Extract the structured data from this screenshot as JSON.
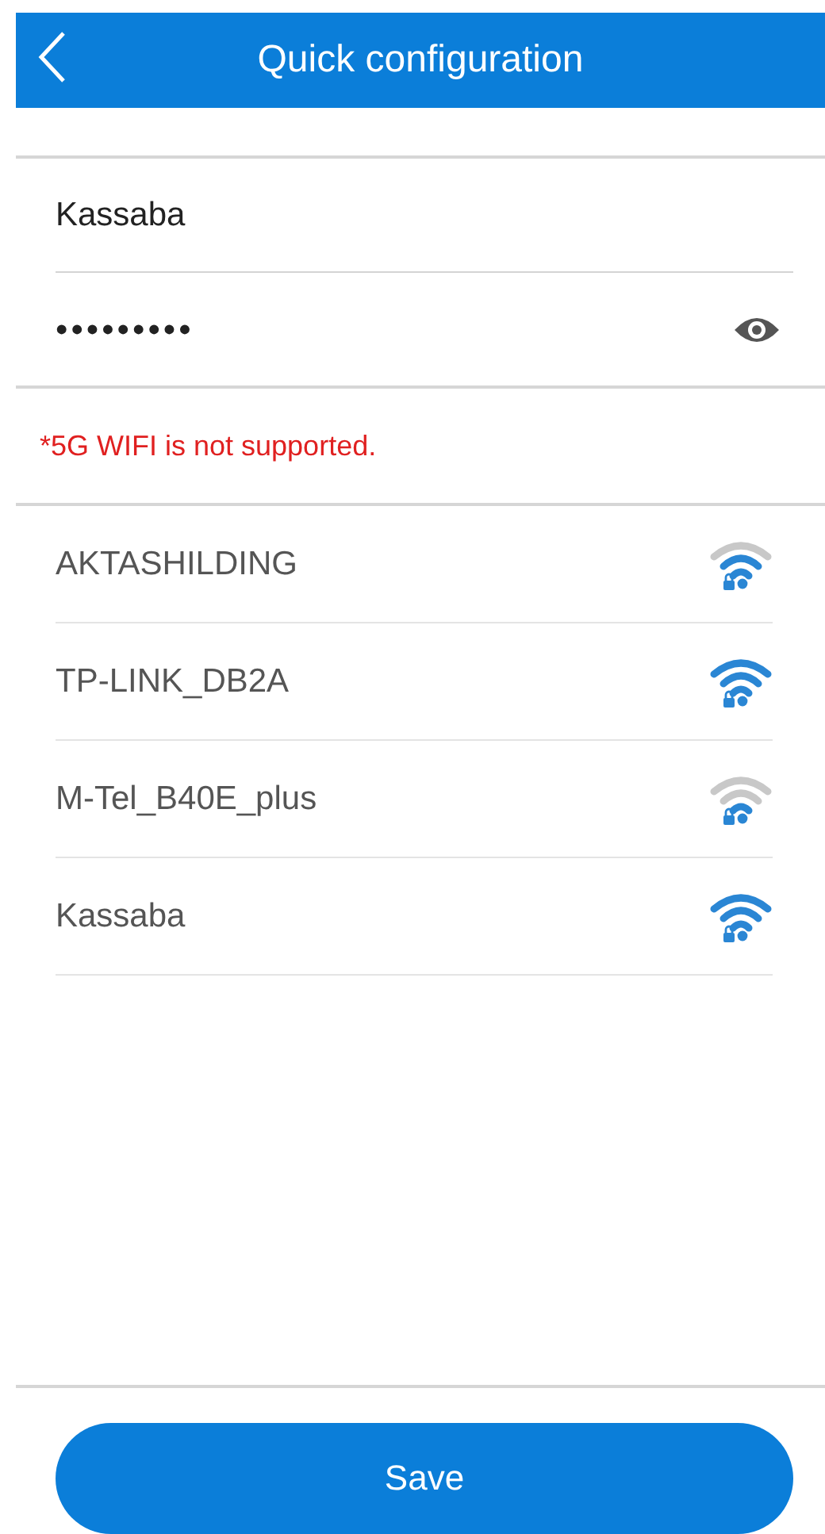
{
  "header": {
    "title": "Quick configuration"
  },
  "ssid_field": {
    "value": "Kassaba"
  },
  "password_field": {
    "value": "•••••••••",
    "visible": false
  },
  "note": "*5G WIFI is not supported.",
  "networks": [
    {
      "name": "AKTASHILDING",
      "kind": "medium"
    },
    {
      "name": "TP-LINK_DB2A",
      "kind": "full"
    },
    {
      "name": "M-Tel_B40E_plus",
      "kind": "low"
    },
    {
      "name": "Kassaba",
      "kind": "full"
    }
  ],
  "save_button": "Save"
}
